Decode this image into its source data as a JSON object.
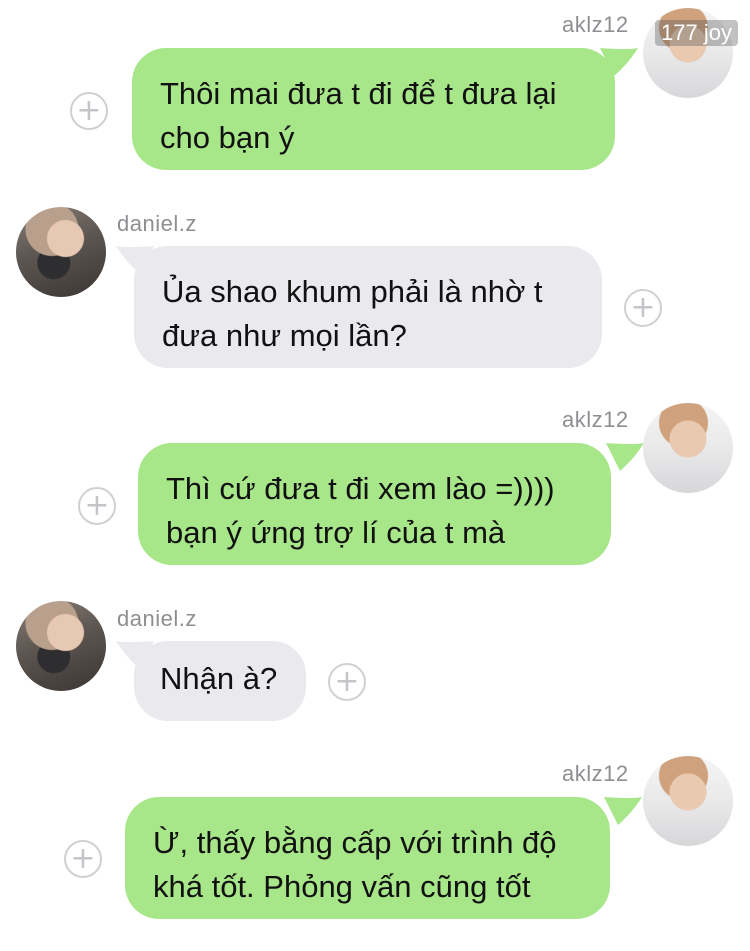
{
  "overlay": {
    "badge": "177 joy"
  },
  "messages": [
    {
      "sender": "aklz12",
      "side": "right",
      "text": "Thôi mai đưa t đi để t đưa lại\ncho bạn ý"
    },
    {
      "sender": "daniel.z",
      "side": "left",
      "text": "Ủa shao khum phải là nhờ t\nđưa như mọi lần?"
    },
    {
      "sender": "aklz12",
      "side": "right",
      "text": "Thì cứ đưa t đi xem lào =))))\nbạn ý ứng trợ lí của t mà"
    },
    {
      "sender": "daniel.z",
      "side": "left",
      "text": "Nhận à?"
    },
    {
      "sender": "aklz12",
      "side": "right",
      "text": "Ừ, thấy bằng cấp với trình độ\nkhá tốt. Phỏng vấn cũng tốt"
    }
  ],
  "colors": {
    "outgoing_bubble": "#a8e68a",
    "incoming_bubble": "#e9e9ee",
    "sender_name": "#8e8e93"
  },
  "icons": {
    "add": "plus-circle-icon",
    "avatar": "profile-avatar"
  }
}
